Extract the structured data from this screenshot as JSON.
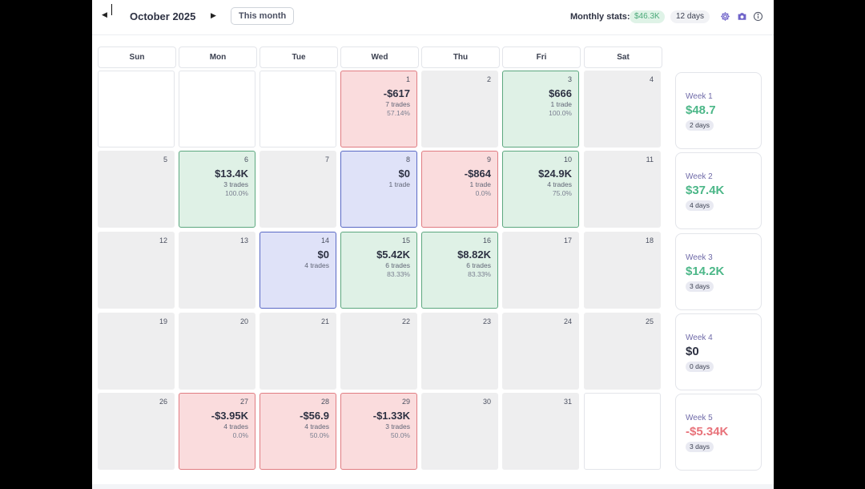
{
  "header": {
    "month": "October 2025",
    "this_month_label": "This month",
    "stats_label": "Monthly stats:",
    "monthly_pnl": "$46.3K",
    "monthly_days": "12 days",
    "icons": [
      "gear-icon",
      "camera-icon",
      "info-icon"
    ]
  },
  "weekdays": [
    "Sun",
    "Mon",
    "Tue",
    "Wed",
    "Thu",
    "Fri",
    "Sat"
  ],
  "colors": {
    "win": "#4cb788",
    "loss": "#e8727a",
    "neutral": "#2d3142",
    "accent": "#6f63c9"
  },
  "weeks": [
    [
      {
        "day": "",
        "status": "empty"
      },
      {
        "day": "",
        "status": "empty"
      },
      {
        "day": "",
        "status": "empty"
      },
      {
        "day": "1",
        "status": "loss",
        "pnl": "-$617",
        "trades": "7 trades",
        "winrate": "57.14%"
      },
      {
        "day": "2",
        "status": "none"
      },
      {
        "day": "3",
        "status": "win",
        "pnl": "$666",
        "trades": "1 trade",
        "winrate": "100.0%"
      },
      {
        "day": "4",
        "status": "none"
      }
    ],
    [
      {
        "day": "5",
        "status": "none"
      },
      {
        "day": "6",
        "status": "win",
        "pnl": "$13.4K",
        "trades": "3 trades",
        "winrate": "100.0%"
      },
      {
        "day": "7",
        "status": "none"
      },
      {
        "day": "8",
        "status": "flat",
        "pnl": "$0",
        "trades": "1 trade",
        "winrate": ""
      },
      {
        "day": "9",
        "status": "loss",
        "pnl": "-$864",
        "trades": "1 trade",
        "winrate": "0.0%"
      },
      {
        "day": "10",
        "status": "win",
        "pnl": "$24.9K",
        "trades": "4 trades",
        "winrate": "75.0%"
      },
      {
        "day": "11",
        "status": "none"
      }
    ],
    [
      {
        "day": "12",
        "status": "none"
      },
      {
        "day": "13",
        "status": "none"
      },
      {
        "day": "14",
        "status": "flat",
        "pnl": "$0",
        "trades": "4 trades",
        "winrate": ""
      },
      {
        "day": "15",
        "status": "win",
        "pnl": "$5.42K",
        "trades": "6 trades",
        "winrate": "83.33%"
      },
      {
        "day": "16",
        "status": "win",
        "pnl": "$8.82K",
        "trades": "6 trades",
        "winrate": "83.33%"
      },
      {
        "day": "17",
        "status": "none"
      },
      {
        "day": "18",
        "status": "none"
      }
    ],
    [
      {
        "day": "19",
        "status": "none"
      },
      {
        "day": "20",
        "status": "none"
      },
      {
        "day": "21",
        "status": "none"
      },
      {
        "day": "22",
        "status": "none"
      },
      {
        "day": "23",
        "status": "none"
      },
      {
        "day": "24",
        "status": "none"
      },
      {
        "day": "25",
        "status": "none"
      }
    ],
    [
      {
        "day": "26",
        "status": "none"
      },
      {
        "day": "27",
        "status": "loss",
        "pnl": "-$3.95K",
        "trades": "4 trades",
        "winrate": "0.0%"
      },
      {
        "day": "28",
        "status": "loss",
        "pnl": "-$56.9",
        "trades": "4 trades",
        "winrate": "50.0%"
      },
      {
        "day": "29",
        "status": "loss",
        "pnl": "-$1.33K",
        "trades": "3 trades",
        "winrate": "50.0%"
      },
      {
        "day": "30",
        "status": "none"
      },
      {
        "day": "31",
        "status": "none"
      },
      {
        "day": "",
        "status": "empty"
      }
    ]
  ],
  "week_summaries": [
    {
      "label": "Week 1",
      "value": "$48.7",
      "days": "2 days",
      "tone": "win"
    },
    {
      "label": "Week 2",
      "value": "$37.4K",
      "days": "4 days",
      "tone": "win"
    },
    {
      "label": "Week 3",
      "value": "$14.2K",
      "days": "3 days",
      "tone": "win"
    },
    {
      "label": "Week 4",
      "value": "$0",
      "days": "0 days",
      "tone": "neutral"
    },
    {
      "label": "Week 5",
      "value": "-$5.34K",
      "days": "3 days",
      "tone": "loss"
    }
  ]
}
